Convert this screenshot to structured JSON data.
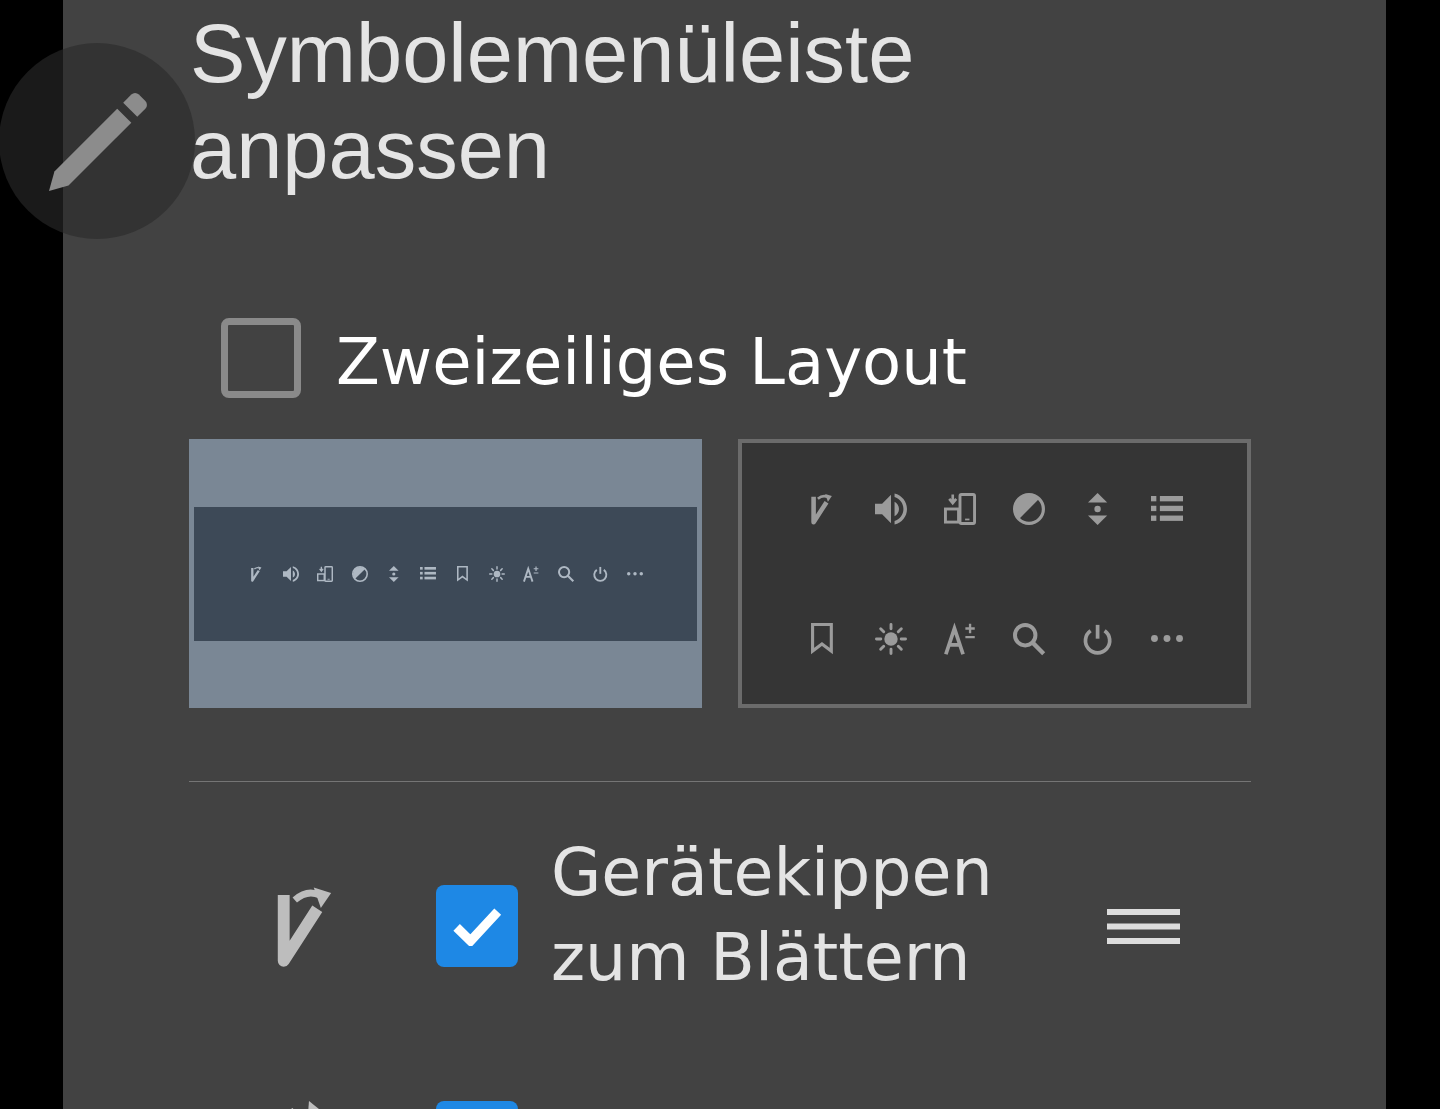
{
  "title": "Symbolemenüleiste anpassen",
  "two_line_layout": {
    "label": "Zweizeiliges Layout",
    "checked": false
  },
  "layout_previews": [
    {
      "kind": "single-row",
      "selected": true
    },
    {
      "kind": "two-row",
      "selected": false
    }
  ],
  "items": [
    {
      "label": "Gerätekippen zum Blättern",
      "checked": true
    },
    {
      "checked": true
    }
  ]
}
